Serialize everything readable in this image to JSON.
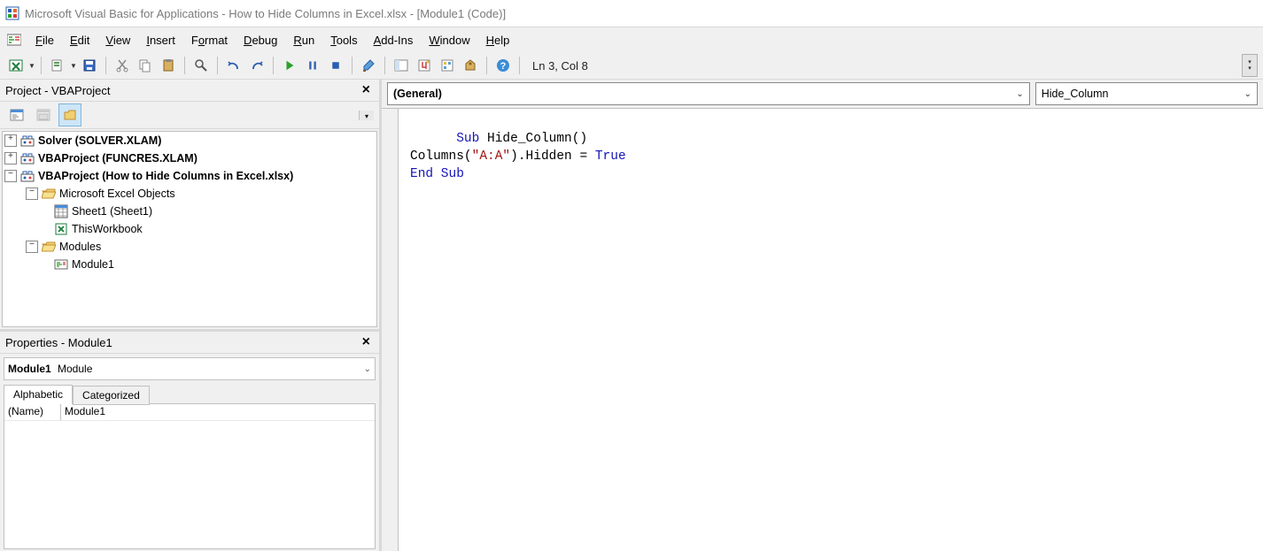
{
  "title": "Microsoft Visual Basic for Applications - How to Hide Columns in Excel.xlsx - [Module1 (Code)]",
  "menu": {
    "file": "File",
    "edit": "Edit",
    "view": "View",
    "insert": "Insert",
    "format": "Format",
    "debug": "Debug",
    "run": "Run",
    "tools": "Tools",
    "addins": "Add-Ins",
    "window": "Window",
    "help": "Help"
  },
  "position": "Ln 3, Col 8",
  "project": {
    "pane_title": "Project - VBAProject",
    "nodes": {
      "solver": "Solver (SOLVER.XLAM)",
      "funcres": "VBAProject (FUNCRES.XLAM)",
      "wb": "VBAProject (How to Hide Columns in Excel.xlsx)",
      "mso": "Microsoft Excel Objects",
      "sheet1": "Sheet1 (Sheet1)",
      "thiswb": "ThisWorkbook",
      "modules": "Modules",
      "module1": "Module1"
    }
  },
  "properties": {
    "pane_title": "Properties - Module1",
    "combo_name": "Module1",
    "combo_type": "Module",
    "tab_alpha": "Alphabetic",
    "tab_cat": "Categorized",
    "row_key": "(Name)",
    "row_val": "Module1"
  },
  "code": {
    "dd_left": "(General)",
    "dd_right": "Hide_Column",
    "l1_sub": "Sub",
    "l1_name": " Hide_Column()",
    "l2_a": "Columns(",
    "l2_str": "\"A:A\"",
    "l2_b": ").Hidden = ",
    "l2_true": "True",
    "l3": "End Sub"
  }
}
